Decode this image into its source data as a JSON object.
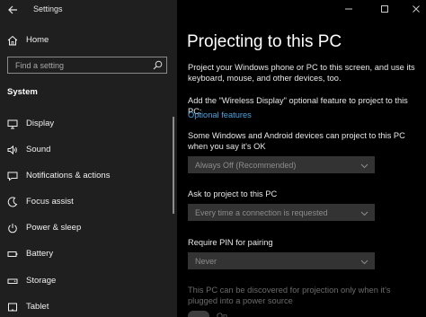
{
  "window": {
    "title": "Settings",
    "controls": [
      "minimize",
      "maximize",
      "close"
    ]
  },
  "sidebar": {
    "home_label": "Home",
    "search_placeholder": "Find a setting",
    "section_title": "System",
    "items": [
      {
        "label": "Display",
        "icon": "display-icon"
      },
      {
        "label": "Sound",
        "icon": "sound-icon"
      },
      {
        "label": "Notifications & actions",
        "icon": "notifications-icon"
      },
      {
        "label": "Focus assist",
        "icon": "focus-assist-icon"
      },
      {
        "label": "Power & sleep",
        "icon": "power-icon"
      },
      {
        "label": "Battery",
        "icon": "battery-icon"
      },
      {
        "label": "Storage",
        "icon": "storage-icon"
      },
      {
        "label": "Tablet",
        "icon": "tablet-icon"
      }
    ]
  },
  "main": {
    "title": "Projecting to this PC",
    "description": "Project your Windows phone or PC to this screen, and use its keyboard, mouse, and other devices, too.",
    "feature_text": "Add the \"Wireless Display\" optional feature to project to this PC:",
    "feature_link": "Optional features",
    "setting1_label": "Some Windows and Android devices can project to this PC when you say it's OK",
    "setting1_value": "Always Off (Recommended)",
    "setting2_label": "Ask to project to this PC",
    "setting2_value": "Every time a connection is requested",
    "setting3_label": "Require PIN for pairing",
    "setting3_value": "Never",
    "power_note": "This PC can be discovered for projection only when it's plugged into a power source",
    "toggle_state": "On"
  },
  "colors": {
    "sidebar_bg": "#1f1f1f",
    "main_bg": "#000000",
    "link": "#4aa3df",
    "dropdown_bg": "#333333"
  }
}
